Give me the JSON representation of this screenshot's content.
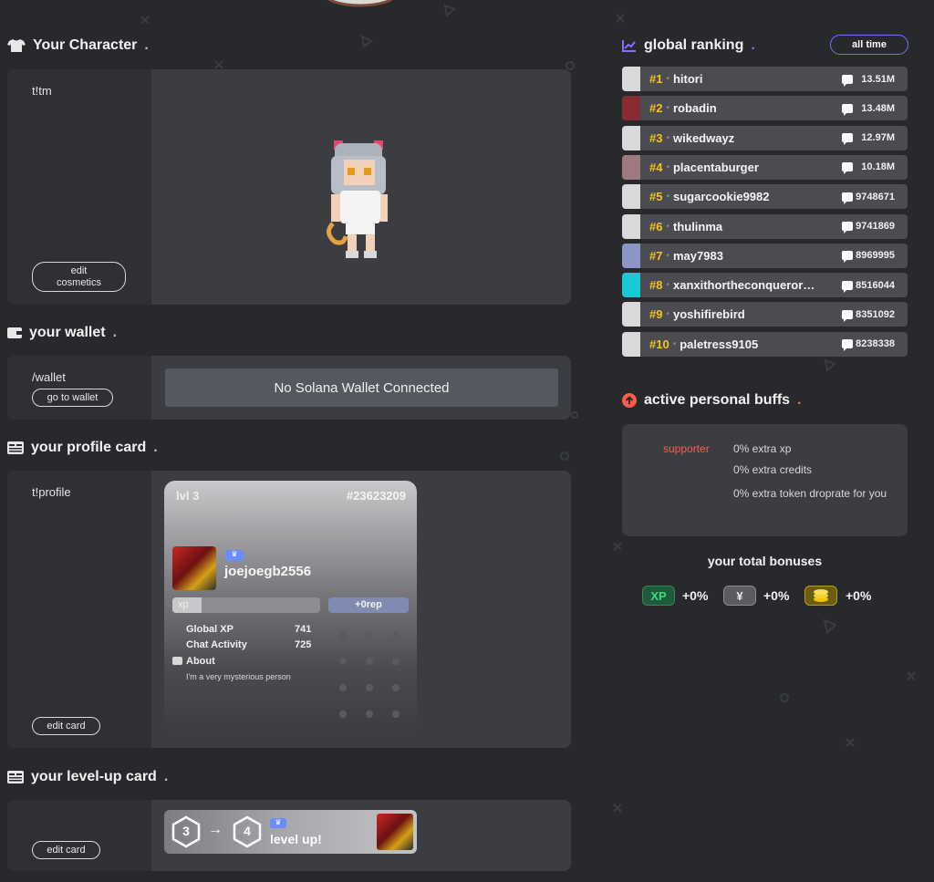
{
  "character": {
    "title": "Your Character",
    "command": "t!tm",
    "edit_label": "edit cosmetics"
  },
  "wallet": {
    "title": "your wallet",
    "command": "/wallet",
    "button_label": "go to wallet",
    "status": "No Solana Wallet Connected"
  },
  "profile": {
    "title": "your profile card",
    "command": "t!profile",
    "edit_label": "edit card",
    "card": {
      "level": "lvl 3",
      "rank": "#23623209",
      "username": "joejoegb2556",
      "badge": "vip-badge-icon",
      "xp_label": "xp",
      "xp_progress": 0.2,
      "rep_label": "+0rep",
      "stats": [
        {
          "label": "Global XP",
          "value": "741"
        },
        {
          "label": "Chat Activity",
          "value": "725"
        }
      ],
      "about_label": "About",
      "about_text": "I'm a very mysterious person"
    }
  },
  "levelup": {
    "title": "your level-up card",
    "edit_label": "edit card",
    "from_level": "3",
    "to_level": "4",
    "message": "level up!"
  },
  "ranking": {
    "title": "global ranking",
    "filter_label": "all time",
    "rows": [
      {
        "pos": "#1",
        "name": "hitori",
        "score": "13.51M",
        "avatar": "#d9d9d9"
      },
      {
        "pos": "#2",
        "name": "robadin",
        "score": "13.48M",
        "avatar": "#8a2a32"
      },
      {
        "pos": "#3",
        "name": "wikedwayz",
        "score": "12.97M",
        "avatar": "#d9d9d9"
      },
      {
        "pos": "#4",
        "name": "placentaburger",
        "score": "10.18M",
        "avatar": "#9b7a80"
      },
      {
        "pos": "#5",
        "name": "sugarcookie9982",
        "score": "9748671",
        "avatar": "#d9d9d9"
      },
      {
        "pos": "#6",
        "name": "thulinma",
        "score": "9741869",
        "avatar": "#d9d9d9"
      },
      {
        "pos": "#7",
        "name": "may7983",
        "score": "8969995",
        "avatar": "#8b95c8"
      },
      {
        "pos": "#8",
        "name": "xanxithortheconqueror…",
        "score": "8516044",
        "avatar": "#19c9d6"
      },
      {
        "pos": "#9",
        "name": "yoshifirebird",
        "score": "8351092",
        "avatar": "#d9d9d9"
      },
      {
        "pos": "#10",
        "name": "paletress9105",
        "score": "8238338",
        "avatar": "#d9d9d9"
      }
    ]
  },
  "buffs": {
    "title": "active personal buffs",
    "source": "supporter",
    "lines": [
      "0% extra xp",
      "0% extra credits",
      "0% extra token droprate for you"
    ]
  },
  "bonuses": {
    "title": "your total bonuses",
    "items": [
      {
        "chip": "XP",
        "value": "+0%",
        "bg": "#1f5a3a",
        "fg": "#3fdc7e",
        "border": "#2e8c55"
      },
      {
        "chip": "¥",
        "value": "+0%",
        "bg": "#5a5c62",
        "fg": "#e8e8e8",
        "border": "#8a8c92"
      },
      {
        "chip": "coins-icon",
        "value": "+0%",
        "bg": "#6b5c12",
        "fg": "#f1c40f",
        "border": "#b89b16"
      }
    ]
  },
  "colors": {
    "accent_purple": "#7a6cff",
    "gold": "#f5c518",
    "supporter_red": "#ff5a4a"
  }
}
